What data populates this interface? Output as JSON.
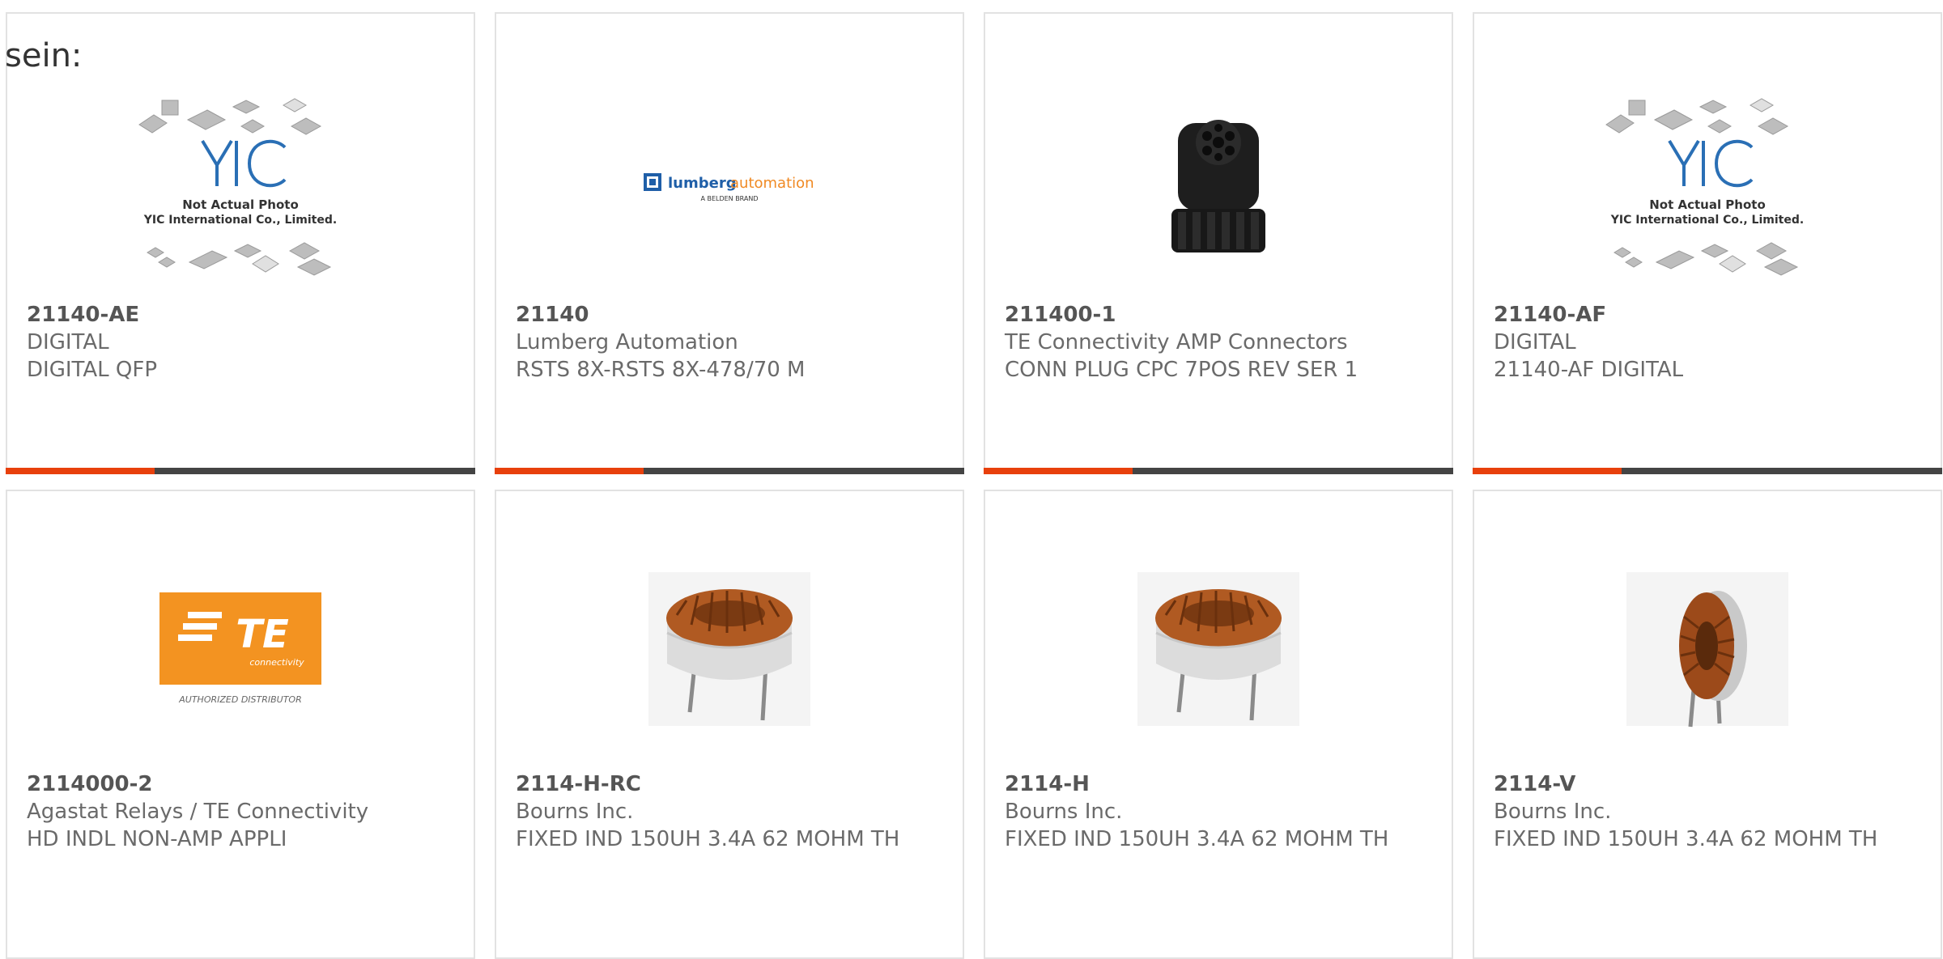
{
  "intro_text": "sein:",
  "colors": {
    "accent": "#e8400c",
    "bar": "#444444",
    "border": "#e2e2e2",
    "text": "#6a6a6a"
  },
  "products": [
    {
      "part_number": "21140-AE",
      "manufacturer": "DIGITAL",
      "description": "DIGITAL QFP",
      "image": "yic-placeholder-photo",
      "image_text": {
        "line1": "Not Actual Photo",
        "line2": "YIC International Co., Limited."
      }
    },
    {
      "part_number": "21140",
      "manufacturer": "Lumberg Automation",
      "description": "RSTS 8X-RSTS 8X-478/70 M",
      "image": "lumberg-automation-logo",
      "image_text": {
        "brand1": "lumberg",
        "brand2": "automation",
        "tagline": "A BELDEN BRAND"
      }
    },
    {
      "part_number": "211400-1",
      "manufacturer": "TE Connectivity AMP Connectors",
      "description": "CONN PLUG CPC 7POS REV SER 1",
      "image": "circular-connector-photo"
    },
    {
      "part_number": "21140-AF",
      "manufacturer": "DIGITAL",
      "description": "21140-AF DIGITAL",
      "image": "yic-placeholder-photo",
      "image_text": {
        "line1": "Not Actual Photo",
        "line2": "YIC International Co., Limited."
      }
    },
    {
      "part_number": "2114000-2",
      "manufacturer": "Agastat Relays / TE Connectivity",
      "description": "HD INDL NON-AMP APPLI",
      "image": "te-connectivity-logo",
      "image_text": {
        "brand": "TE",
        "sub": "connectivity",
        "caption": "AUTHORIZED DISTRIBUTOR"
      }
    },
    {
      "part_number": "2114-H-RC",
      "manufacturer": "Bourns Inc.",
      "description": "FIXED IND 150UH 3.4A 62 MOHM TH",
      "image": "toroid-inductor-horizontal-photo"
    },
    {
      "part_number": "2114-H",
      "manufacturer": "Bourns Inc.",
      "description": "FIXED IND 150UH 3.4A 62 MOHM TH",
      "image": "toroid-inductor-horizontal-photo"
    },
    {
      "part_number": "2114-V",
      "manufacturer": "Bourns Inc.",
      "description": "FIXED IND 150UH 3.4A 62 MOHM TH",
      "image": "toroid-inductor-vertical-photo"
    }
  ]
}
